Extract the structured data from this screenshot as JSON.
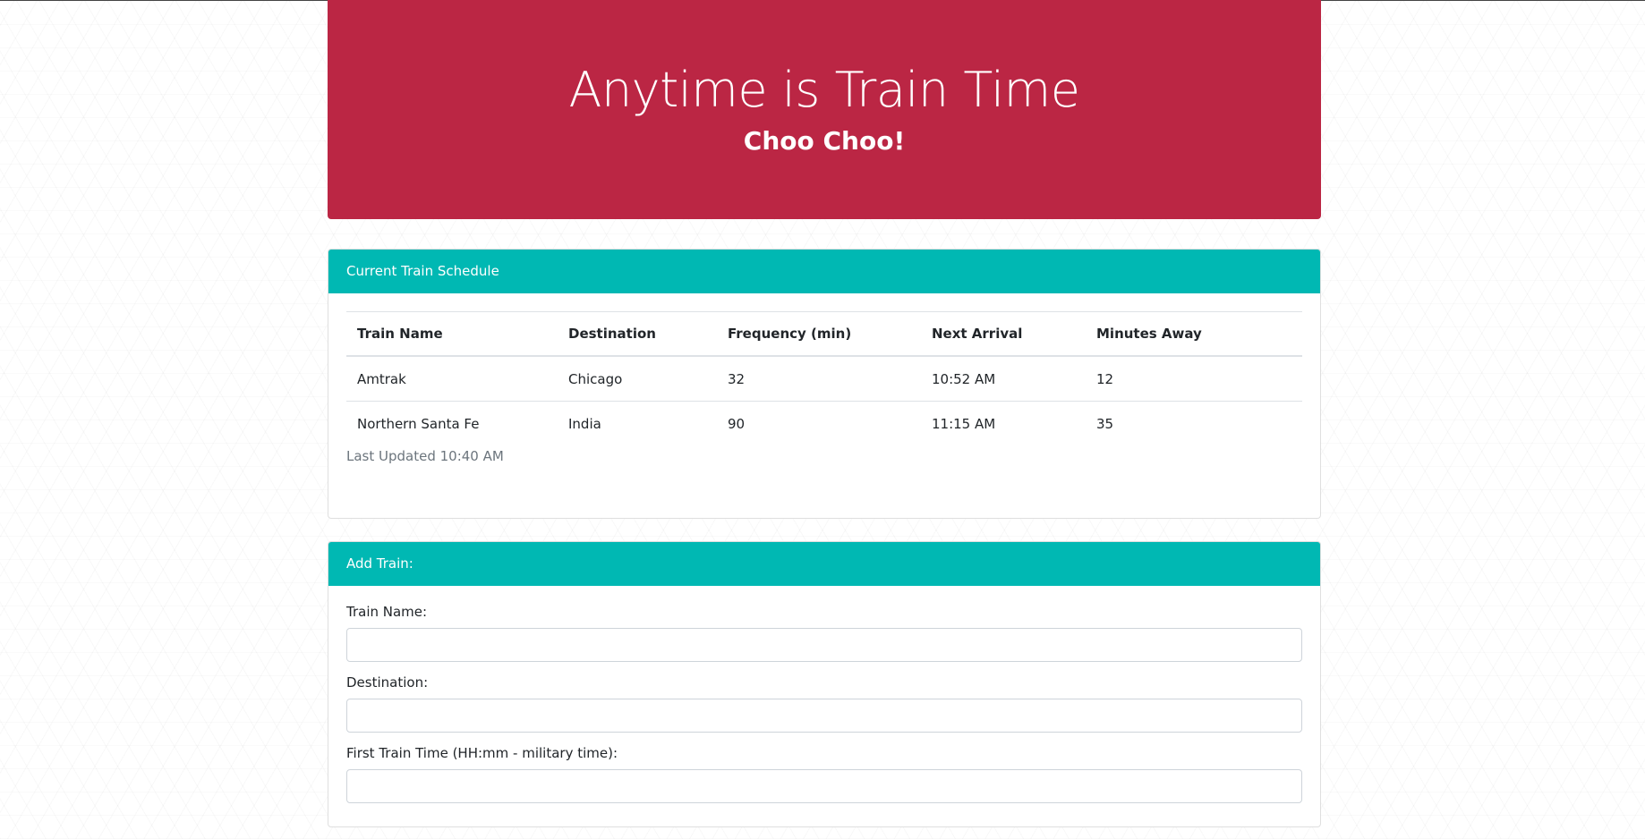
{
  "header": {
    "title": "Anytime is Train Time",
    "subtitle": "Choo Choo!"
  },
  "schedule": {
    "heading": "Current Train Schedule",
    "columns": [
      "Train Name",
      "Destination",
      "Frequency (min)",
      "Next Arrival",
      "Minutes Away"
    ],
    "rows": [
      [
        "Amtrak",
        "Chicago",
        "32",
        "10:52 AM",
        "12"
      ],
      [
        "Northern Santa Fe",
        "India",
        "90",
        "11:15 AM",
        "35"
      ]
    ],
    "last_updated": "Last Updated 10:40 AM"
  },
  "add_train": {
    "heading": "Add Train:",
    "fields": {
      "train_name": {
        "label": "Train Name:",
        "value": ""
      },
      "destination": {
        "label": "Destination:",
        "value": ""
      },
      "first_time": {
        "label": "First Train Time (HH:mm - military time):",
        "value": ""
      }
    }
  },
  "colors": {
    "jumbotron": "#bb2644",
    "card_header": "#00b8b3"
  }
}
